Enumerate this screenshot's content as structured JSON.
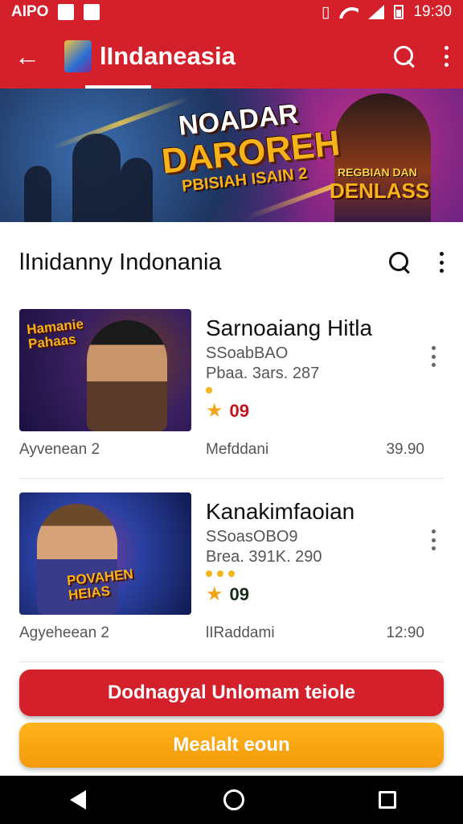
{
  "status_bar": {
    "carrier": "AIPO",
    "time": "19:30",
    "icons": [
      "vibrate-icon",
      "wifi-icon",
      "signal-icon",
      "battery-icon"
    ]
  },
  "app_bar": {
    "title": "lIndaneasia",
    "icons": [
      "back-arrow-icon",
      "app-logo-icon",
      "search-icon",
      "more-vert-icon"
    ]
  },
  "banner": {
    "line1": "NOADAR",
    "line2": "DAROREH",
    "line3": "PBISIAH ISAIN 2",
    "badge_top": "REGBIAN DAN",
    "badge": "DENLASS"
  },
  "section": {
    "title": "lInidanny Indonania"
  },
  "items": [
    {
      "title": "Sarnoaiang Hitla",
      "subtitle": "SSoabBAO",
      "meta": "Pbaa. 3ars. 287",
      "rating": "09",
      "thumb_caption": "Hamanie Pahaas",
      "footer_left": "Ayvenean 2",
      "footer_mid": "Mefddani",
      "footer_right": "39.90"
    },
    {
      "title": "Kanakimfaoian",
      "subtitle": "SSoasOBO9",
      "meta": "Brea. 391K. 290",
      "rating": "09",
      "thumb_caption": "POVAHEN HEIAS",
      "footer_left": "Agyeheean 2",
      "footer_mid": "lIRaddami",
      "footer_right": "12:90"
    }
  ],
  "buttons": {
    "primary": "Dodnagyal Unlomam teiole",
    "secondary": "Mealalt eoun"
  },
  "colors": {
    "brand_red": "#d4202a",
    "accent_orange": "#f39a0c",
    "star": "#f2a51c"
  }
}
